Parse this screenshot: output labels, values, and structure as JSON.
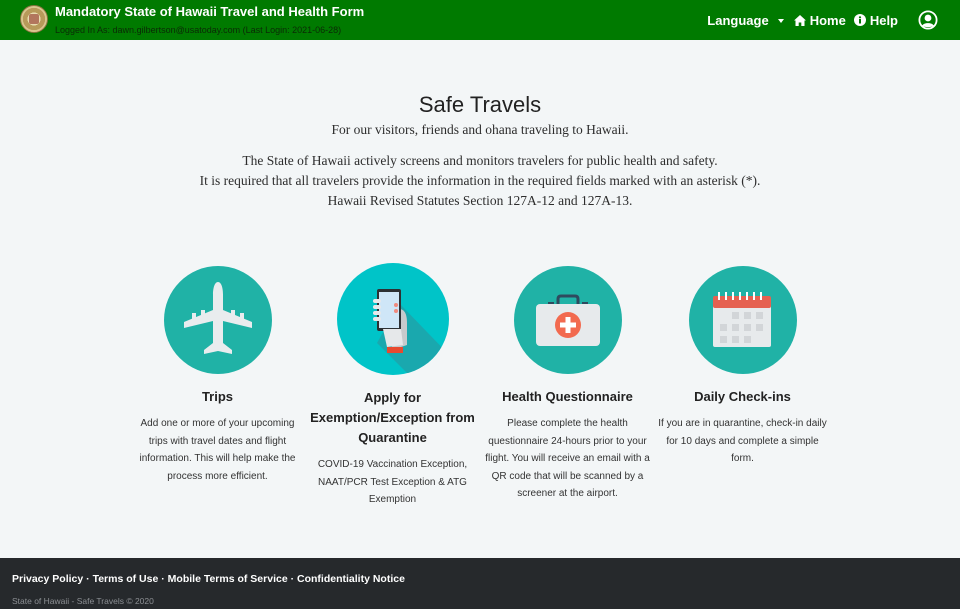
{
  "header": {
    "title": "Mandatory State of Hawaii Travel and Health Form",
    "login_info": "Logged In As: dawn.gilbertson@usatoday.com (Last Login: 2021-06-28)",
    "logo_icon": "state-seal-icon",
    "nav": {
      "language": "Language",
      "home": "Home",
      "help": "Help",
      "home_icon": "home-icon",
      "help_icon": "info-circle-icon",
      "user_icon": "user-circle-icon"
    },
    "color": "#007a00"
  },
  "intro": {
    "title": "Safe Travels",
    "subtitle": "For our visitors, friends and ohana traveling to Hawaii.",
    "lines": [
      "The State of Hawaii actively screens and monitors travelers for public health and safety.",
      "It is required that all travelers provide the information in the required fields marked with an asterisk (*).",
      "Hawaii Revised Statutes Section 127A-12 and 127A-13."
    ]
  },
  "cards": [
    {
      "icon": "airplane-icon",
      "title": "Trips",
      "description": "Add one or more of your upcoming trips with travel dates and flight information. This will help make the process more efficient.",
      "color": "#20b2a6"
    },
    {
      "icon": "phone-in-hand-icon",
      "title": "Apply for Exemption/Exception from Quarantine",
      "description": "COVID-19 Vaccination Exception, NAAT/PCR Test Exception & ATG Exemption",
      "color": "#00c4c8"
    },
    {
      "icon": "first-aid-kit-icon",
      "title": "Health Questionnaire",
      "description": "Please complete the health questionnaire 24-hours prior to your flight. You will receive an email with a QR code that will be scanned by a screener at the airport.",
      "color": "#20b2a6"
    },
    {
      "icon": "calendar-icon",
      "title": "Daily Check-ins",
      "description": "If you are in quarantine, check-in daily for 10 days and complete a simple form.",
      "color": "#20b2a6"
    }
  ],
  "footer": {
    "links": [
      "Privacy Policy",
      "Terms of Use",
      "Mobile Terms of Service",
      "Confidentiality Notice"
    ],
    "separator": " · ",
    "copyright": "State of Hawaii - Safe Travels © 2020"
  }
}
